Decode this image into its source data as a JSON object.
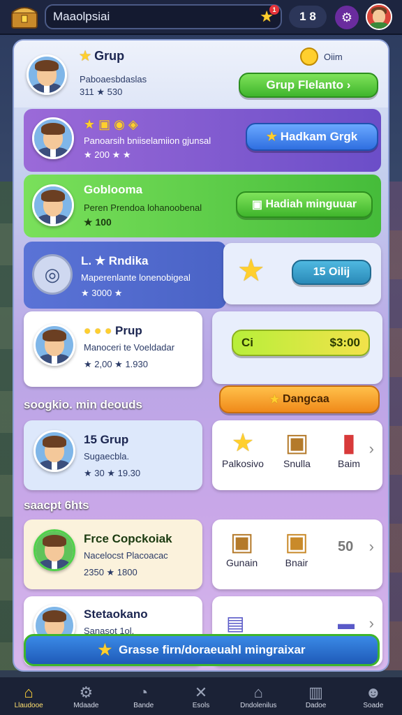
{
  "topbar": {
    "search_value": "Maaolpsiai",
    "notif_count": "1",
    "currency": "1 8",
    "logo_icon": "treasure-chest-icon",
    "settings_icon": "gear-icon"
  },
  "header": {
    "title": "Grup",
    "line1": "Paboaesbdaslas",
    "line2": "311 ★ 530",
    "right_info": "Oiim",
    "button": "Grup  Flelanto"
  },
  "rows": [
    {
      "title": "Panoarsih bniiselamiion gjunsal",
      "meta": "★ 200  ★ ★",
      "button": "Hadkam Grgk"
    },
    {
      "title": "Goblooma",
      "sub": "Peren Prendoa lohanoobenal",
      "meta": "★ 100",
      "button": "Hadiah minguuar"
    },
    {
      "title": "L. ★ Rndika",
      "sub": "Maperenlante lonenobigeal",
      "meta": "★ 3000 ★",
      "button": "15 Oilij"
    }
  ],
  "prup_card": {
    "title": "Prup",
    "sub": "Manoceri te Voeldadar",
    "meta": "★ 2,00  ★ 1.930"
  },
  "price_button": {
    "left": "Ci",
    "price": "$3:00"
  },
  "orange_button": "Dangcaa",
  "section1": "soogkio. min deouds",
  "group_card": {
    "title": "15 Grup",
    "sub": "Sugaecbla.",
    "meta": "★ 30   ★ 19.30"
  },
  "shop1": [
    "Palkosivo",
    "Snulla",
    "Baim"
  ],
  "section2": "saacpt 6hts",
  "free_card": {
    "title": "Frce Copckoiak",
    "sub": "Nacelocst  Placoacac",
    "meta": "2350 ★ 1800"
  },
  "shop2": [
    "Gunain",
    "Bnair"
  ],
  "shop2_value": "50",
  "last_card": {
    "title": "Stetaokano",
    "sub": "Sanasot 1ol."
  },
  "cta": "Grasse firn/doraeuahl mingraixar",
  "nav": [
    {
      "label": "Llaudooe",
      "icon": "home-icon"
    },
    {
      "label": "Mdaade",
      "icon": "gear-icon"
    },
    {
      "label": "Bande",
      "icon": "chat-icon"
    },
    {
      "label": "Esols",
      "icon": "tools-icon"
    },
    {
      "label": "Dndolenilus",
      "icon": "house-icon"
    },
    {
      "label": "Dadoe",
      "icon": "book-icon"
    },
    {
      "label": "Soade",
      "icon": "profile-icon"
    }
  ],
  "colors": {
    "accent_green": "#3fb52c",
    "accent_blue": "#2f6fe0",
    "accent_orange": "#f08a1a",
    "background": "#2b3a5e"
  }
}
